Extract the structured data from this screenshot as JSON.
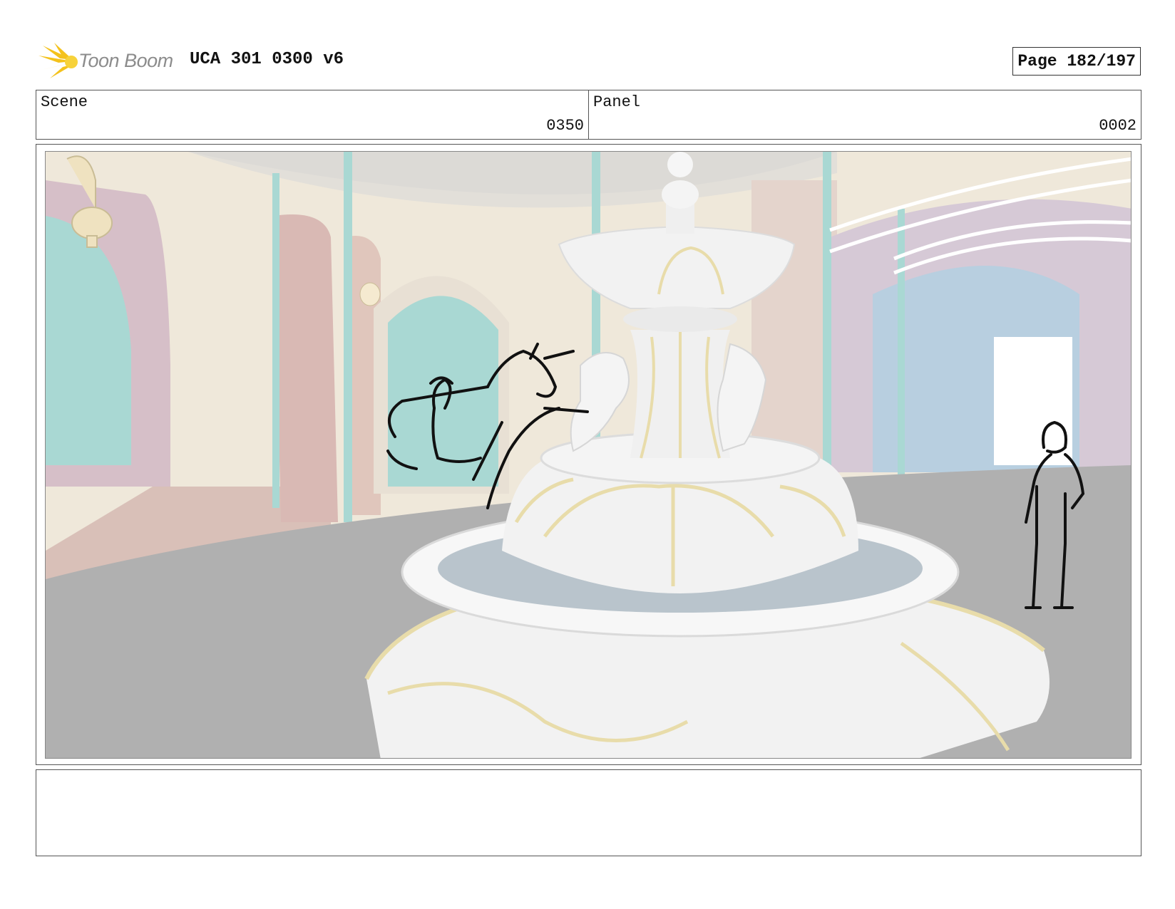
{
  "header": {
    "logo_text": "Toon Boom",
    "title": "UCA 301 0300 v6",
    "page": "Page 182/197"
  },
  "scene": {
    "label": "Scene",
    "value": "0350"
  },
  "panel": {
    "label": "Panel",
    "value": "0002"
  },
  "artwork": {
    "icon": "storyboard-image",
    "colors": {
      "floor": "#b0b0b0",
      "wall": "#efe8da",
      "teal": "#a9d8d3",
      "pink": "#d9b9b4",
      "gold": "#e8dcaa",
      "fountain": "#f2f2f2"
    }
  },
  "notes": {
    "text": ""
  }
}
